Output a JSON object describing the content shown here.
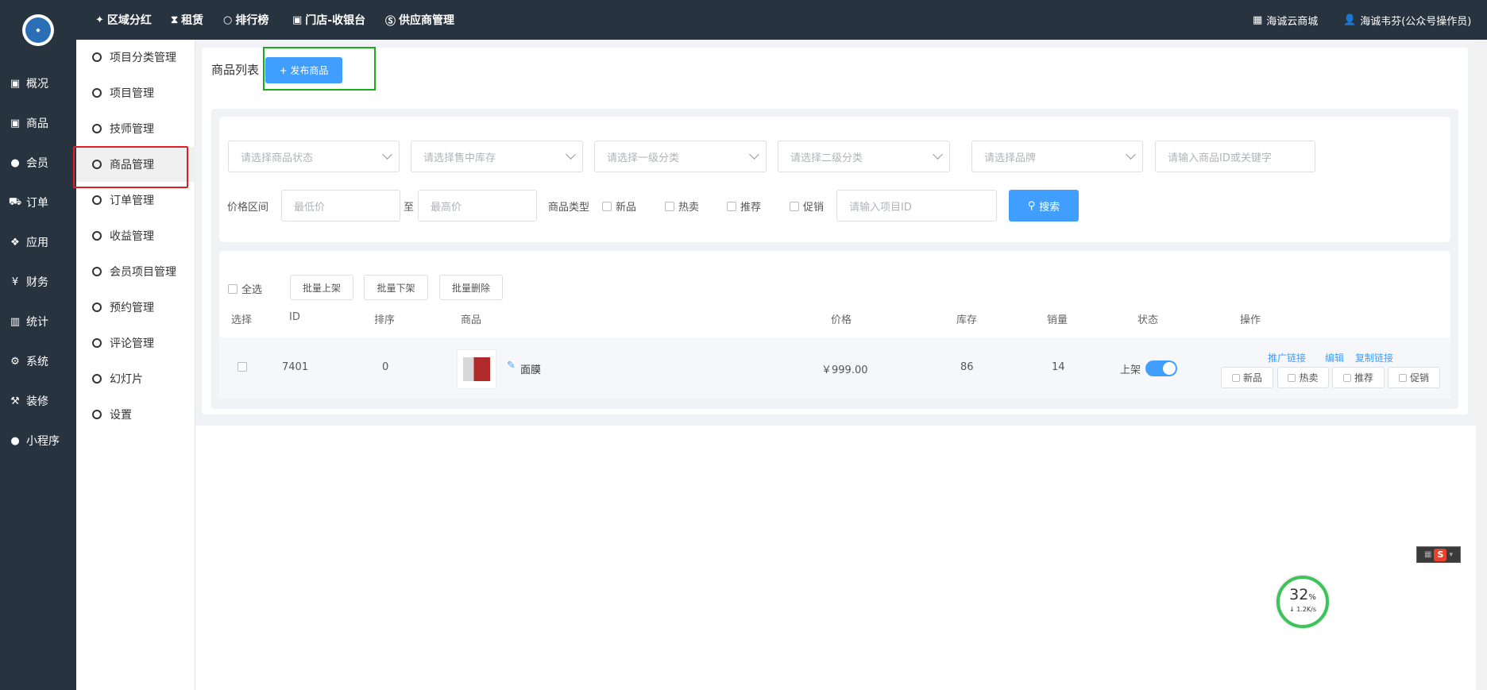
{
  "colors": {
    "sidebar_bg": "#283340",
    "accent": "#409eff",
    "main_bg": "#f0f2f5"
  },
  "topbar": {
    "menus": [
      {
        "label": "区域分红",
        "icon": "pin-icon"
      },
      {
        "label": "租赁",
        "icon": "hourglass-icon"
      },
      {
        "label": "排行榜",
        "icon": "circle-icon"
      },
      {
        "label": "门店-收银台",
        "icon": "cash-icon"
      },
      {
        "label": "供应商管理",
        "icon": "skype-icon"
      }
    ],
    "store_label": "海诚云商城",
    "user_label": "海诚韦芬(公众号操作员)"
  },
  "sidebar": {
    "items": [
      {
        "label": "概况",
        "icon": "overview-icon"
      },
      {
        "label": "商品",
        "icon": "goods-icon"
      },
      {
        "label": "会员",
        "icon": "members-icon"
      },
      {
        "label": "订单",
        "icon": "cart-icon"
      },
      {
        "label": "应用",
        "icon": "apps-icon"
      },
      {
        "label": "财务",
        "icon": "yen-icon"
      },
      {
        "label": "统计",
        "icon": "stats-icon"
      },
      {
        "label": "系统",
        "icon": "gears-icon"
      },
      {
        "label": "装修",
        "icon": "hammer-icon"
      },
      {
        "label": "小程序",
        "icon": "wechat-icon"
      }
    ]
  },
  "subnav": {
    "items": [
      {
        "label": "项目分类管理"
      },
      {
        "label": "项目管理"
      },
      {
        "label": "技师管理"
      },
      {
        "label": "商品管理",
        "active": true
      },
      {
        "label": "订单管理"
      },
      {
        "label": "收益管理"
      },
      {
        "label": "会员项目管理"
      },
      {
        "label": "预约管理"
      },
      {
        "label": "评论管理"
      },
      {
        "label": "幻灯片"
      },
      {
        "label": "设置"
      }
    ]
  },
  "page": {
    "title": "商品列表",
    "publish_button": "+ 发布商品"
  },
  "filters": {
    "status_placeholder": "请选择商品状态",
    "stock_placeholder": "请选择售中库存",
    "cat1_placeholder": "请选择一级分类",
    "cat2_placeholder": "请选择二级分类",
    "brand_placeholder": "请选择品牌",
    "keyword_placeholder": "请输入商品ID或关键字",
    "price_label": "价格区间",
    "min_price_placeholder": "最低价",
    "to_label": "至",
    "max_price_placeholder": "最高价",
    "type_label": "商品类型",
    "type_options": [
      "新品",
      "热卖",
      "推荐",
      "促销"
    ],
    "project_id_placeholder": "请输入项目ID",
    "search_button": "搜索"
  },
  "table": {
    "select_all": "全选",
    "batch_buttons": [
      "批量上架",
      "批量下架",
      "批量删除"
    ],
    "headers": [
      "选择",
      "ID",
      "排序",
      "商品",
      "价格",
      "库存",
      "销量",
      "状态",
      "操作"
    ],
    "rows": [
      {
        "id": "7401",
        "sort": "0",
        "name": "面膜",
        "price": "￥999.00",
        "stock": "86",
        "sales": "14",
        "status_label": "上架",
        "status_on": true,
        "links": [
          "推广链接",
          "编辑",
          "复制链接"
        ],
        "tags": [
          "新品",
          "热卖",
          "推荐",
          "促销"
        ]
      }
    ]
  },
  "widgets": {
    "speed_percent": "32",
    "speed_unit": "%",
    "speed_rate": "↓ 1.2K/s",
    "ime_label": "S"
  }
}
